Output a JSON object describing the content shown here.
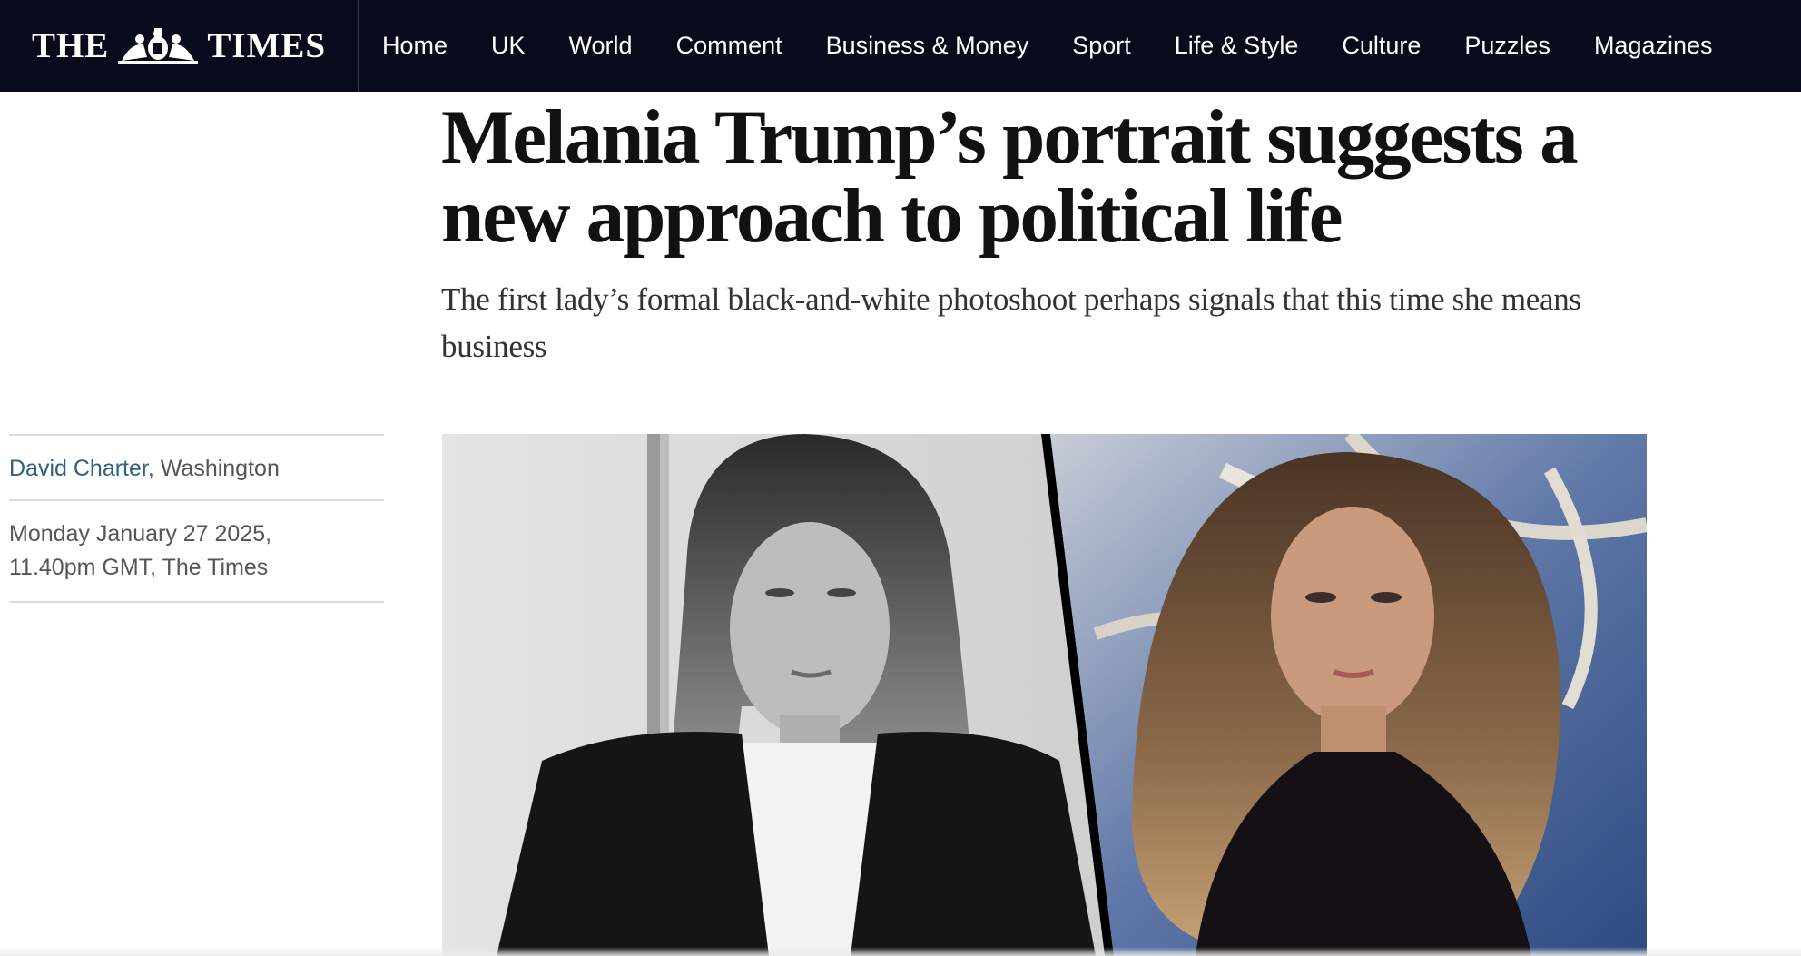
{
  "masthead": {
    "word_left": "THE",
    "word_right": "TIMES",
    "crest_icon": "royal-crest-icon"
  },
  "nav": {
    "items": [
      {
        "label": "Home"
      },
      {
        "label": "UK"
      },
      {
        "label": "World"
      },
      {
        "label": "Comment"
      },
      {
        "label": "Business & Money"
      },
      {
        "label": "Sport"
      },
      {
        "label": "Life & Style"
      },
      {
        "label": "Culture"
      },
      {
        "label": "Puzzles"
      },
      {
        "label": "Magazines"
      }
    ]
  },
  "article": {
    "headline": "Melania Trump’s portrait suggests a new approach to political life",
    "standfirst": "The first lady’s formal black-and-white photoshoot perhaps signals that this time she means business",
    "author": "David Charter",
    "location": ", Washington",
    "dateline": "Monday January 27 2025, 11.40pm GMT, The Times"
  },
  "colors": {
    "nav_background": "#080b1c",
    "author_link": "#305f84",
    "headline_text": "#111111"
  }
}
